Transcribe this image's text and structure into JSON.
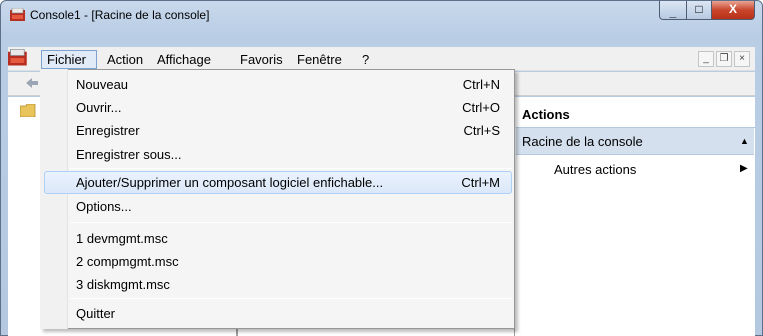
{
  "window": {
    "title": "Console1 - [Racine de la console]",
    "min_symbol": "_",
    "max_symbol": "□",
    "close_symbol": "X"
  },
  "menubar": {
    "items": [
      "Fichier",
      "Action",
      "Affichage",
      "Favoris",
      "Fenêtre",
      "?"
    ],
    "mdi_minimize": "_",
    "mdi_restore": "❐",
    "mdi_close": "×"
  },
  "actions_pane": {
    "title": "Actions",
    "selected": "Racine de la console",
    "more": "Autres actions"
  },
  "file_menu": {
    "new": {
      "label": "Nouveau",
      "shortcut": "Ctrl+N"
    },
    "open": {
      "label": "Ouvrir...",
      "shortcut": "Ctrl+O"
    },
    "save": {
      "label": "Enregistrer",
      "shortcut": "Ctrl+S"
    },
    "save_as": {
      "label": "Enregistrer sous..."
    },
    "add_remove": {
      "label": "Ajouter/Supprimer un composant logiciel enfichable...",
      "shortcut": "Ctrl+M"
    },
    "options": {
      "label": "Options..."
    },
    "recent": [
      "1 devmgmt.msc",
      "2 compmgmt.msc",
      "3 diskmgmt.msc"
    ],
    "quit": {
      "label": "Quitter"
    }
  },
  "colors": {
    "highlight": "#dbe8f9",
    "actions_selected": "#d4e0ee",
    "close_button": "#c9462c"
  }
}
